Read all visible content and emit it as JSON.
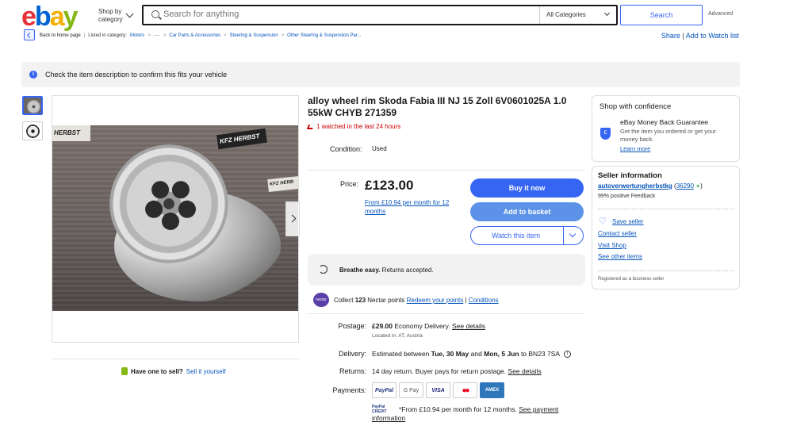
{
  "header": {
    "logo": [
      "e",
      "b",
      "a",
      "y"
    ],
    "shop_by_category": "Shop by category",
    "search_placeholder": "Search for anything",
    "category_select": "All Categories",
    "search_button": "Search",
    "advanced": "Advanced"
  },
  "breadcrumb": {
    "back": "Back to home page",
    "listed_in": "Listed in category:",
    "items": [
      "Motors",
      "···",
      "Car Parts & Accessories",
      "Steering & Suspension",
      "Other Steering & Suspension Par..."
    ],
    "share": "Share",
    "add_to_watch": "Add to Watch list"
  },
  "banner": {
    "text": "Check the item description to confirm this fits your vehicle"
  },
  "photo": {
    "tags": [
      "HERBST",
      "KFZ HERBST",
      "KFZ HERB"
    ]
  },
  "left": {
    "have_one": "Have one to sell?",
    "sell_it": "Sell it yourself"
  },
  "item": {
    "title": "alloy wheel rim Skoda Fabia III NJ 15 Zoll 6V0601025A 1.0 55kW CHYB 271359",
    "watched": "1 watched in the last 24 hours",
    "condition_label": "Condition:",
    "condition_value": "Used",
    "price_label": "Price:",
    "price": "£123.00",
    "finance": "From £10.94 per month for 12 months",
    "buy_now": "Buy it now",
    "add_to_basket": "Add to basket",
    "watch_item": "Watch this item",
    "returns_bold": "Breathe easy.",
    "returns_rest": "Returns accepted.",
    "nectar_icon": "nectar",
    "nectar_collect": "Collect",
    "nectar_points": "123",
    "nectar_rest": "Nectar points",
    "nectar_redeem": "Redeem your points",
    "nectar_sep": "|",
    "nectar_conditions": "Conditions",
    "postage_label": "Postage:",
    "postage_price": "£29.00",
    "postage_type": "Economy Delivery.",
    "see_details": "See details",
    "located": "Located in: AT, Austria",
    "delivery_label": "Delivery:",
    "delivery_pre": "Estimated between",
    "delivery_from": "Tue, 30 May",
    "delivery_and": "and",
    "delivery_to": "Mon, 5 Jun",
    "delivery_post": "to BN23 7SA",
    "returns_label": "Returns:",
    "returns_text": "14 day return. Buyer pays for return postage.",
    "returns_details": "See details",
    "payments_label": "Payments:",
    "payment_methods": [
      "PayPal",
      "G Pay",
      "VISA",
      "●●",
      "AMEX"
    ],
    "paypal_credit": "PayPal CREDIT",
    "paypal_from": "*From £10.94 per month for 12 months.",
    "paypal_see": "See payment",
    "paypal_info": "information"
  },
  "confidence": {
    "title": "Shop with confidence",
    "icon": "£",
    "mbg_title": "eBay Money Back Guarantee",
    "mbg_text": "Get the item you ordered or get your money back.",
    "learn_more": "Learn more"
  },
  "seller": {
    "title": "Seller information",
    "name": "autoverwertungherbstkg",
    "feedback_open": "(",
    "feedback": "36290",
    "feedback_close": ")",
    "positive": "99% positive Feedback",
    "save_seller": "Save seller",
    "contact": "Contact seller",
    "visit_shop": "Visit Shop",
    "other_items": "See other items",
    "registered": "Registered as a business seller"
  },
  "colors": {
    "accent": "#3665f3",
    "link": "#0654ba",
    "watched_red": "#cc0000",
    "basket": "#5c93e8"
  },
  "icons": [
    "search-icon",
    "chevron-down-icon",
    "back-arrow-icon",
    "info-icon",
    "next-arrow-icon",
    "sell-tag-icon",
    "eye-icon",
    "return-icon",
    "nectar-icon",
    "money-back-shield-icon",
    "heart-icon",
    "info-circle-icon",
    "star-icon"
  ]
}
